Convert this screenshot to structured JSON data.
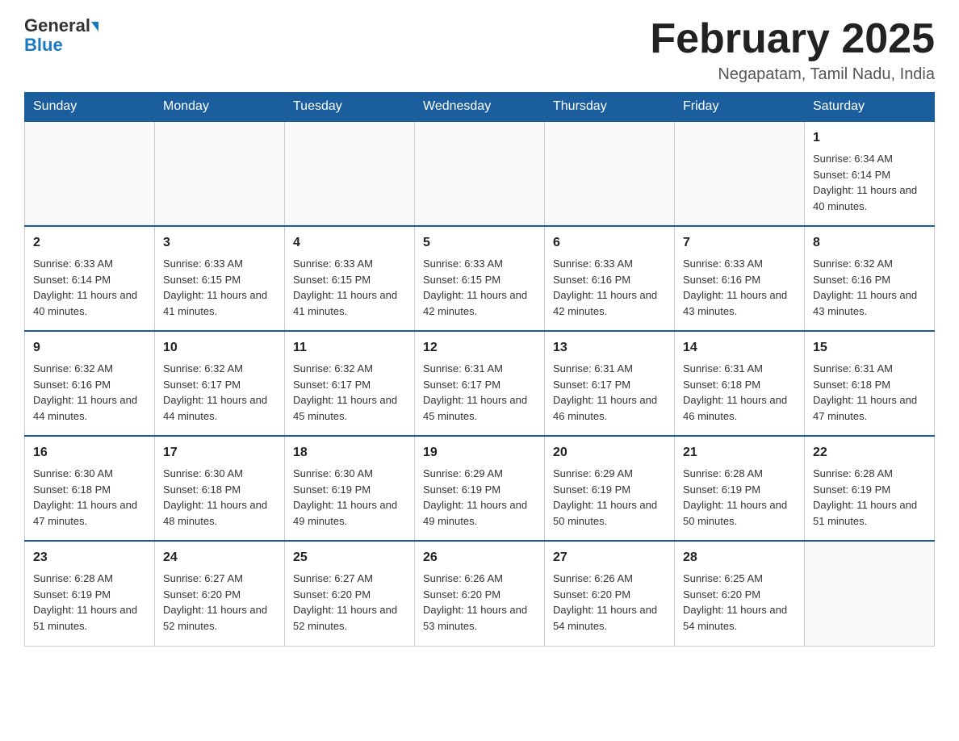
{
  "header": {
    "logo": {
      "general": "General",
      "arrow": "▶",
      "blue": "Blue"
    },
    "title": "February 2025",
    "location": "Negapatam, Tamil Nadu, India"
  },
  "weekdays": [
    "Sunday",
    "Monday",
    "Tuesday",
    "Wednesday",
    "Thursday",
    "Friday",
    "Saturday"
  ],
  "weeks": [
    {
      "days": [
        {
          "num": "",
          "info": ""
        },
        {
          "num": "",
          "info": ""
        },
        {
          "num": "",
          "info": ""
        },
        {
          "num": "",
          "info": ""
        },
        {
          "num": "",
          "info": ""
        },
        {
          "num": "",
          "info": ""
        },
        {
          "num": "1",
          "info": "Sunrise: 6:34 AM\nSunset: 6:14 PM\nDaylight: 11 hours and 40 minutes."
        }
      ]
    },
    {
      "days": [
        {
          "num": "2",
          "info": "Sunrise: 6:33 AM\nSunset: 6:14 PM\nDaylight: 11 hours and 40 minutes."
        },
        {
          "num": "3",
          "info": "Sunrise: 6:33 AM\nSunset: 6:15 PM\nDaylight: 11 hours and 41 minutes."
        },
        {
          "num": "4",
          "info": "Sunrise: 6:33 AM\nSunset: 6:15 PM\nDaylight: 11 hours and 41 minutes."
        },
        {
          "num": "5",
          "info": "Sunrise: 6:33 AM\nSunset: 6:15 PM\nDaylight: 11 hours and 42 minutes."
        },
        {
          "num": "6",
          "info": "Sunrise: 6:33 AM\nSunset: 6:16 PM\nDaylight: 11 hours and 42 minutes."
        },
        {
          "num": "7",
          "info": "Sunrise: 6:33 AM\nSunset: 6:16 PM\nDaylight: 11 hours and 43 minutes."
        },
        {
          "num": "8",
          "info": "Sunrise: 6:32 AM\nSunset: 6:16 PM\nDaylight: 11 hours and 43 minutes."
        }
      ]
    },
    {
      "days": [
        {
          "num": "9",
          "info": "Sunrise: 6:32 AM\nSunset: 6:16 PM\nDaylight: 11 hours and 44 minutes."
        },
        {
          "num": "10",
          "info": "Sunrise: 6:32 AM\nSunset: 6:17 PM\nDaylight: 11 hours and 44 minutes."
        },
        {
          "num": "11",
          "info": "Sunrise: 6:32 AM\nSunset: 6:17 PM\nDaylight: 11 hours and 45 minutes."
        },
        {
          "num": "12",
          "info": "Sunrise: 6:31 AM\nSunset: 6:17 PM\nDaylight: 11 hours and 45 minutes."
        },
        {
          "num": "13",
          "info": "Sunrise: 6:31 AM\nSunset: 6:17 PM\nDaylight: 11 hours and 46 minutes."
        },
        {
          "num": "14",
          "info": "Sunrise: 6:31 AM\nSunset: 6:18 PM\nDaylight: 11 hours and 46 minutes."
        },
        {
          "num": "15",
          "info": "Sunrise: 6:31 AM\nSunset: 6:18 PM\nDaylight: 11 hours and 47 minutes."
        }
      ]
    },
    {
      "days": [
        {
          "num": "16",
          "info": "Sunrise: 6:30 AM\nSunset: 6:18 PM\nDaylight: 11 hours and 47 minutes."
        },
        {
          "num": "17",
          "info": "Sunrise: 6:30 AM\nSunset: 6:18 PM\nDaylight: 11 hours and 48 minutes."
        },
        {
          "num": "18",
          "info": "Sunrise: 6:30 AM\nSunset: 6:19 PM\nDaylight: 11 hours and 49 minutes."
        },
        {
          "num": "19",
          "info": "Sunrise: 6:29 AM\nSunset: 6:19 PM\nDaylight: 11 hours and 49 minutes."
        },
        {
          "num": "20",
          "info": "Sunrise: 6:29 AM\nSunset: 6:19 PM\nDaylight: 11 hours and 50 minutes."
        },
        {
          "num": "21",
          "info": "Sunrise: 6:28 AM\nSunset: 6:19 PM\nDaylight: 11 hours and 50 minutes."
        },
        {
          "num": "22",
          "info": "Sunrise: 6:28 AM\nSunset: 6:19 PM\nDaylight: 11 hours and 51 minutes."
        }
      ]
    },
    {
      "days": [
        {
          "num": "23",
          "info": "Sunrise: 6:28 AM\nSunset: 6:19 PM\nDaylight: 11 hours and 51 minutes."
        },
        {
          "num": "24",
          "info": "Sunrise: 6:27 AM\nSunset: 6:20 PM\nDaylight: 11 hours and 52 minutes."
        },
        {
          "num": "25",
          "info": "Sunrise: 6:27 AM\nSunset: 6:20 PM\nDaylight: 11 hours and 52 minutes."
        },
        {
          "num": "26",
          "info": "Sunrise: 6:26 AM\nSunset: 6:20 PM\nDaylight: 11 hours and 53 minutes."
        },
        {
          "num": "27",
          "info": "Sunrise: 6:26 AM\nSunset: 6:20 PM\nDaylight: 11 hours and 54 minutes."
        },
        {
          "num": "28",
          "info": "Sunrise: 6:25 AM\nSunset: 6:20 PM\nDaylight: 11 hours and 54 minutes."
        },
        {
          "num": "",
          "info": ""
        }
      ]
    }
  ]
}
